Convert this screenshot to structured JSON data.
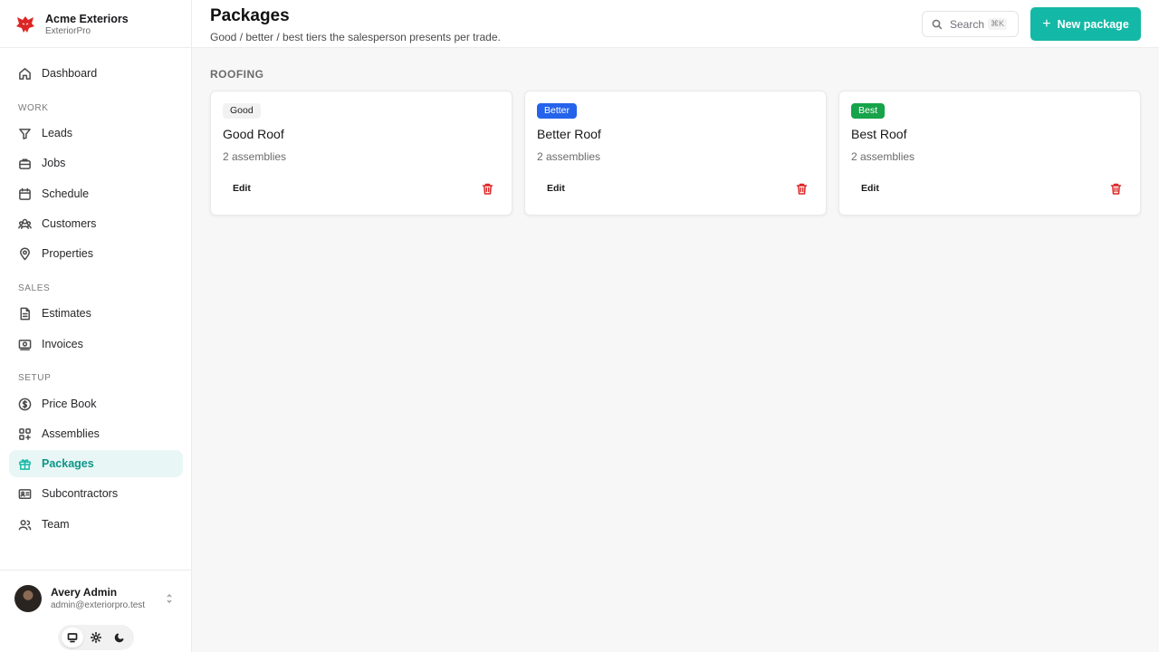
{
  "brand": {
    "name": "Acme Exteriors",
    "product": "ExteriorPro",
    "logo_icon": "wolf-logo-icon",
    "logo_color": "#dc2626"
  },
  "sidebar": {
    "dashboard": {
      "label": "Dashboard",
      "icon": "home-icon"
    },
    "groups": {
      "work": "WORK",
      "sales": "SALES",
      "setup": "SETUP"
    },
    "items": {
      "leads": {
        "label": "Leads",
        "icon": "funnel-icon"
      },
      "jobs": {
        "label": "Jobs",
        "icon": "briefcase-icon"
      },
      "schedule": {
        "label": "Schedule",
        "icon": "calendar-icon"
      },
      "customers": {
        "label": "Customers",
        "icon": "users-icon"
      },
      "properties": {
        "label": "Properties",
        "icon": "map-pin-icon"
      },
      "estimates": {
        "label": "Estimates",
        "icon": "document-icon"
      },
      "invoices": {
        "label": "Invoices",
        "icon": "receipt-icon"
      },
      "price_book": {
        "label": "Price Book",
        "icon": "dollar-circle-icon"
      },
      "assemblies": {
        "label": "Assemblies",
        "icon": "grid-plus-icon"
      },
      "packages": {
        "label": "Packages",
        "icon": "gift-icon",
        "active": true
      },
      "subcontractors": {
        "label": "Subcontractors",
        "icon": "id-card-icon"
      },
      "team": {
        "label": "Team",
        "icon": "team-icon"
      }
    },
    "user": {
      "name": "Avery Admin",
      "email": "admin@exteriorpro.test"
    },
    "theme_switcher": {
      "options": [
        "system",
        "light",
        "dark"
      ],
      "selected": "system"
    }
  },
  "header": {
    "title": "Packages",
    "subtitle": "Good / better / best tiers the salesperson presents per trade.",
    "search": {
      "placeholder": "Search",
      "shortcut": "⌘K"
    },
    "new_button": "New package"
  },
  "main": {
    "section": "ROOFING",
    "cards": [
      {
        "tier": "Good",
        "title": "Good Roof",
        "meta": "2 assemblies",
        "edit": "Edit",
        "badge_color": "#f2f2f2"
      },
      {
        "tier": "Better",
        "title": "Better Roof",
        "meta": "2 assemblies",
        "edit": "Edit",
        "badge_color": "#2563eb"
      },
      {
        "tier": "Best",
        "title": "Best Roof",
        "meta": "2 assemblies",
        "edit": "Edit",
        "badge_color": "#16a34a"
      }
    ]
  },
  "colors": {
    "accent": "#14b8a6",
    "danger": "#dc2626"
  }
}
